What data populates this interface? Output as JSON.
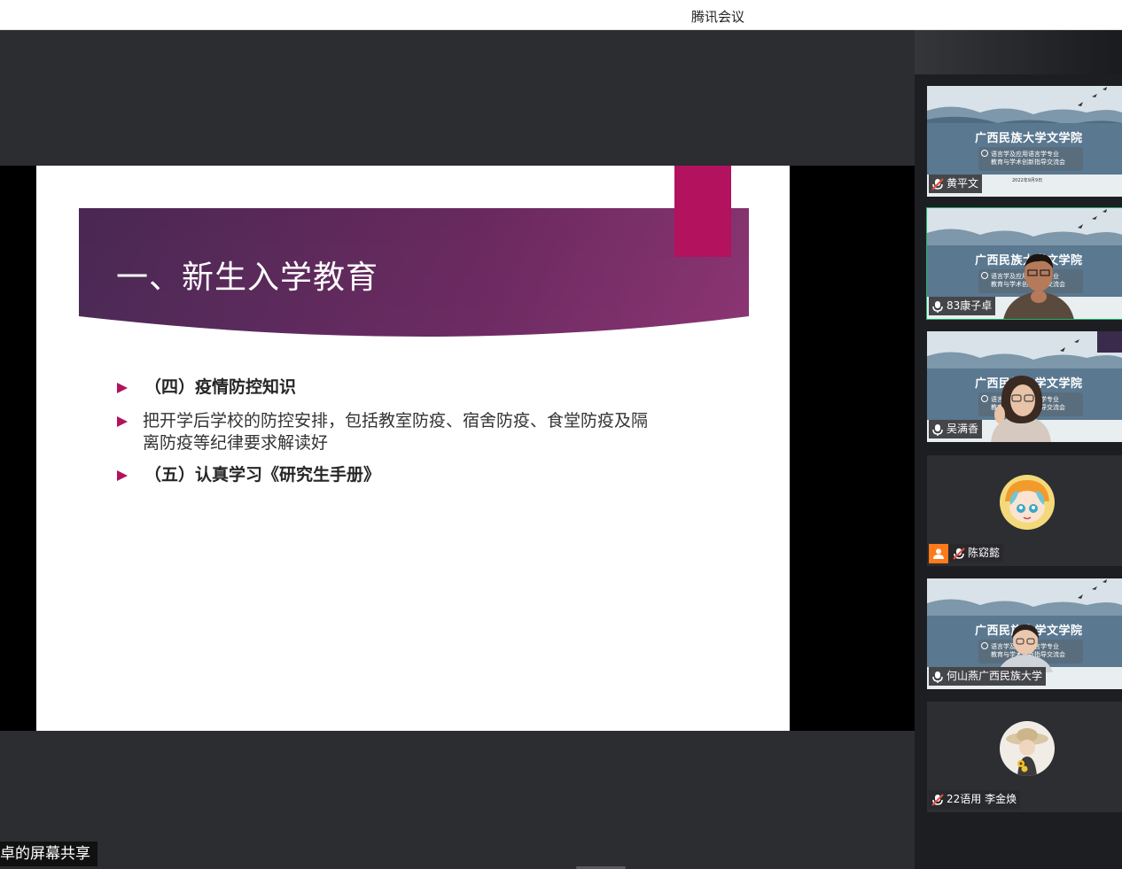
{
  "window": {
    "title": "腾讯会议"
  },
  "slide": {
    "title": "一、新生入学教育",
    "bullets": [
      {
        "text": "（四）疫情防控知识"
      },
      {
        "text": "把开学后学校的防控安排，包括教室防疫、宿舍防疫、食堂防疫及隔离防疫等纪律要求解读好"
      },
      {
        "text": "（五）认真学习《研究生手册》"
      }
    ]
  },
  "share_label": "卓的屏幕共享",
  "background": {
    "banner_title": "广西民族大学文学院",
    "banner_subtitle_line1": "语言学及应用语言学专业",
    "banner_subtitle_line2": "教育与学术创新指导交流会",
    "banner_date": "2022年9月9日"
  },
  "participants": [
    {
      "name": "黄平文",
      "mic": "muted",
      "video": "background"
    },
    {
      "name": "83康子卓",
      "mic": "on",
      "video": "camera",
      "active": true
    },
    {
      "name": "吴满香",
      "mic": "on",
      "video": "camera"
    },
    {
      "name": "陈窈懿",
      "mic": "muted",
      "video": "avatar"
    },
    {
      "name": "何山燕广西民族大学",
      "mic": "on",
      "video": "camera"
    },
    {
      "name": "22语用 李金焕",
      "mic": "muted",
      "video": "avatar"
    }
  ],
  "colors": {
    "banner_purple": "#5a2c5e",
    "banner_magenta": "#8a2a6b",
    "pink_tab": "#b2125e",
    "bullet_arrow": "#b2125e",
    "active_speaker": "#23b46b",
    "muted_mic": "#e84a3b"
  },
  "icons": {
    "mic": "microphone-icon",
    "mic_muted": "microphone-muted-icon",
    "bullet": "triangle-right-icon",
    "user": "user-icon"
  }
}
